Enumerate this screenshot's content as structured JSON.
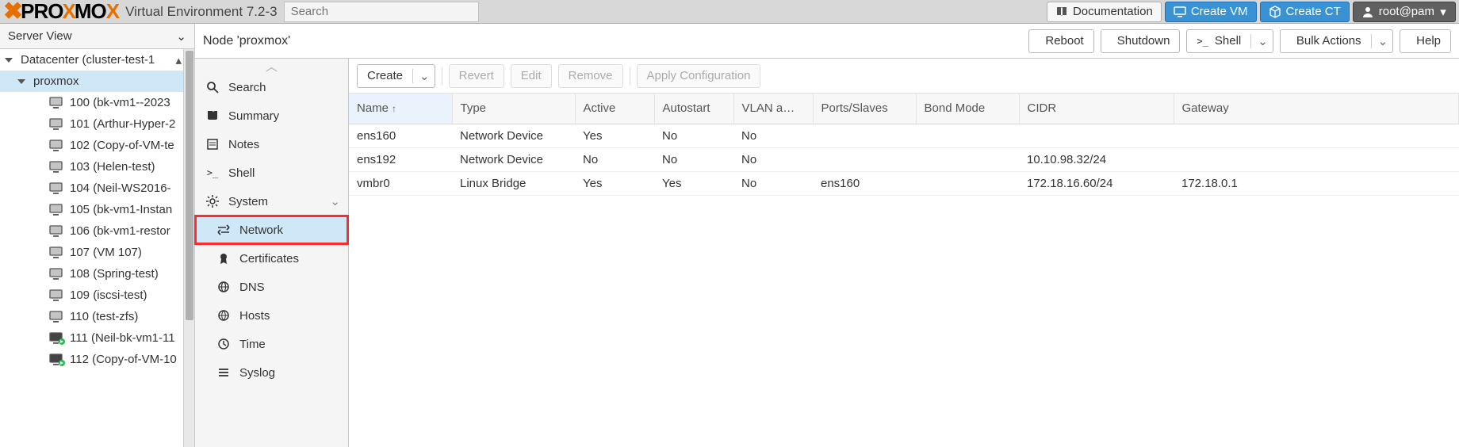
{
  "header": {
    "product": "PROXMOX",
    "env_label": "Virtual Environment 7.2-3",
    "search_placeholder": "Search",
    "documentation": "Documentation",
    "create_vm": "Create VM",
    "create_ct": "Create CT",
    "user": "root@pam"
  },
  "left": {
    "view_label": "Server View",
    "datacenter": "Datacenter (cluster-test-1",
    "node": "proxmox",
    "vms": [
      {
        "label": "100 (bk-vm1--2023",
        "on": false
      },
      {
        "label": "101 (Arthur-Hyper-2",
        "on": false
      },
      {
        "label": "102 (Copy-of-VM-te",
        "on": false
      },
      {
        "label": "103 (Helen-test)",
        "on": false
      },
      {
        "label": "104 (Neil-WS2016-",
        "on": false
      },
      {
        "label": "105 (bk-vm1-Instan",
        "on": false
      },
      {
        "label": "106 (bk-vm1-restor",
        "on": false
      },
      {
        "label": "107 (VM 107)",
        "on": false
      },
      {
        "label": "108 (Spring-test)",
        "on": false
      },
      {
        "label": "109 (iscsi-test)",
        "on": false
      },
      {
        "label": "110 (test-zfs)",
        "on": false
      },
      {
        "label": "111 (Neil-bk-vm1-11",
        "on": true
      },
      {
        "label": "112 (Copy-of-VM-10",
        "on": true
      }
    ]
  },
  "subnav": {
    "items": [
      {
        "key": "search",
        "label": "Search",
        "child": false
      },
      {
        "key": "summary",
        "label": "Summary",
        "child": false
      },
      {
        "key": "notes",
        "label": "Notes",
        "child": false
      },
      {
        "key": "shell",
        "label": "Shell",
        "child": false
      },
      {
        "key": "system",
        "label": "System",
        "child": false,
        "expandable": true
      },
      {
        "key": "network",
        "label": "Network",
        "child": true,
        "selected": true,
        "highlight": true
      },
      {
        "key": "certificates",
        "label": "Certificates",
        "child": true
      },
      {
        "key": "dns",
        "label": "DNS",
        "child": true
      },
      {
        "key": "hosts",
        "label": "Hosts",
        "child": true
      },
      {
        "key": "time",
        "label": "Time",
        "child": true
      },
      {
        "key": "syslog",
        "label": "Syslog",
        "child": true
      }
    ]
  },
  "content": {
    "title": "Node 'proxmox'",
    "actions": {
      "reboot": "Reboot",
      "shutdown": "Shutdown",
      "shell": "Shell",
      "bulk": "Bulk Actions",
      "help": "Help"
    },
    "toolbar": {
      "create": "Create",
      "revert": "Revert",
      "edit": "Edit",
      "remove": "Remove",
      "apply": "Apply Configuration"
    },
    "columns": {
      "name": "Name",
      "type": "Type",
      "active": "Active",
      "autostart": "Autostart",
      "vlan": "VLAN a…",
      "ports": "Ports/Slaves",
      "bond": "Bond Mode",
      "cidr": "CIDR",
      "gateway": "Gateway"
    },
    "rows": [
      {
        "name": "ens160",
        "type": "Network Device",
        "active": "Yes",
        "autostart": "No",
        "vlan": "No",
        "ports": "",
        "bond": "",
        "cidr": "",
        "gateway": ""
      },
      {
        "name": "ens192",
        "type": "Network Device",
        "active": "No",
        "autostart": "No",
        "vlan": "No",
        "ports": "",
        "bond": "",
        "cidr": "10.10.98.32/24",
        "gateway": ""
      },
      {
        "name": "vmbr0",
        "type": "Linux Bridge",
        "active": "Yes",
        "autostart": "Yes",
        "vlan": "No",
        "ports": "ens160",
        "bond": "",
        "cidr": "172.18.16.60/24",
        "gateway": "172.18.0.1"
      }
    ]
  }
}
